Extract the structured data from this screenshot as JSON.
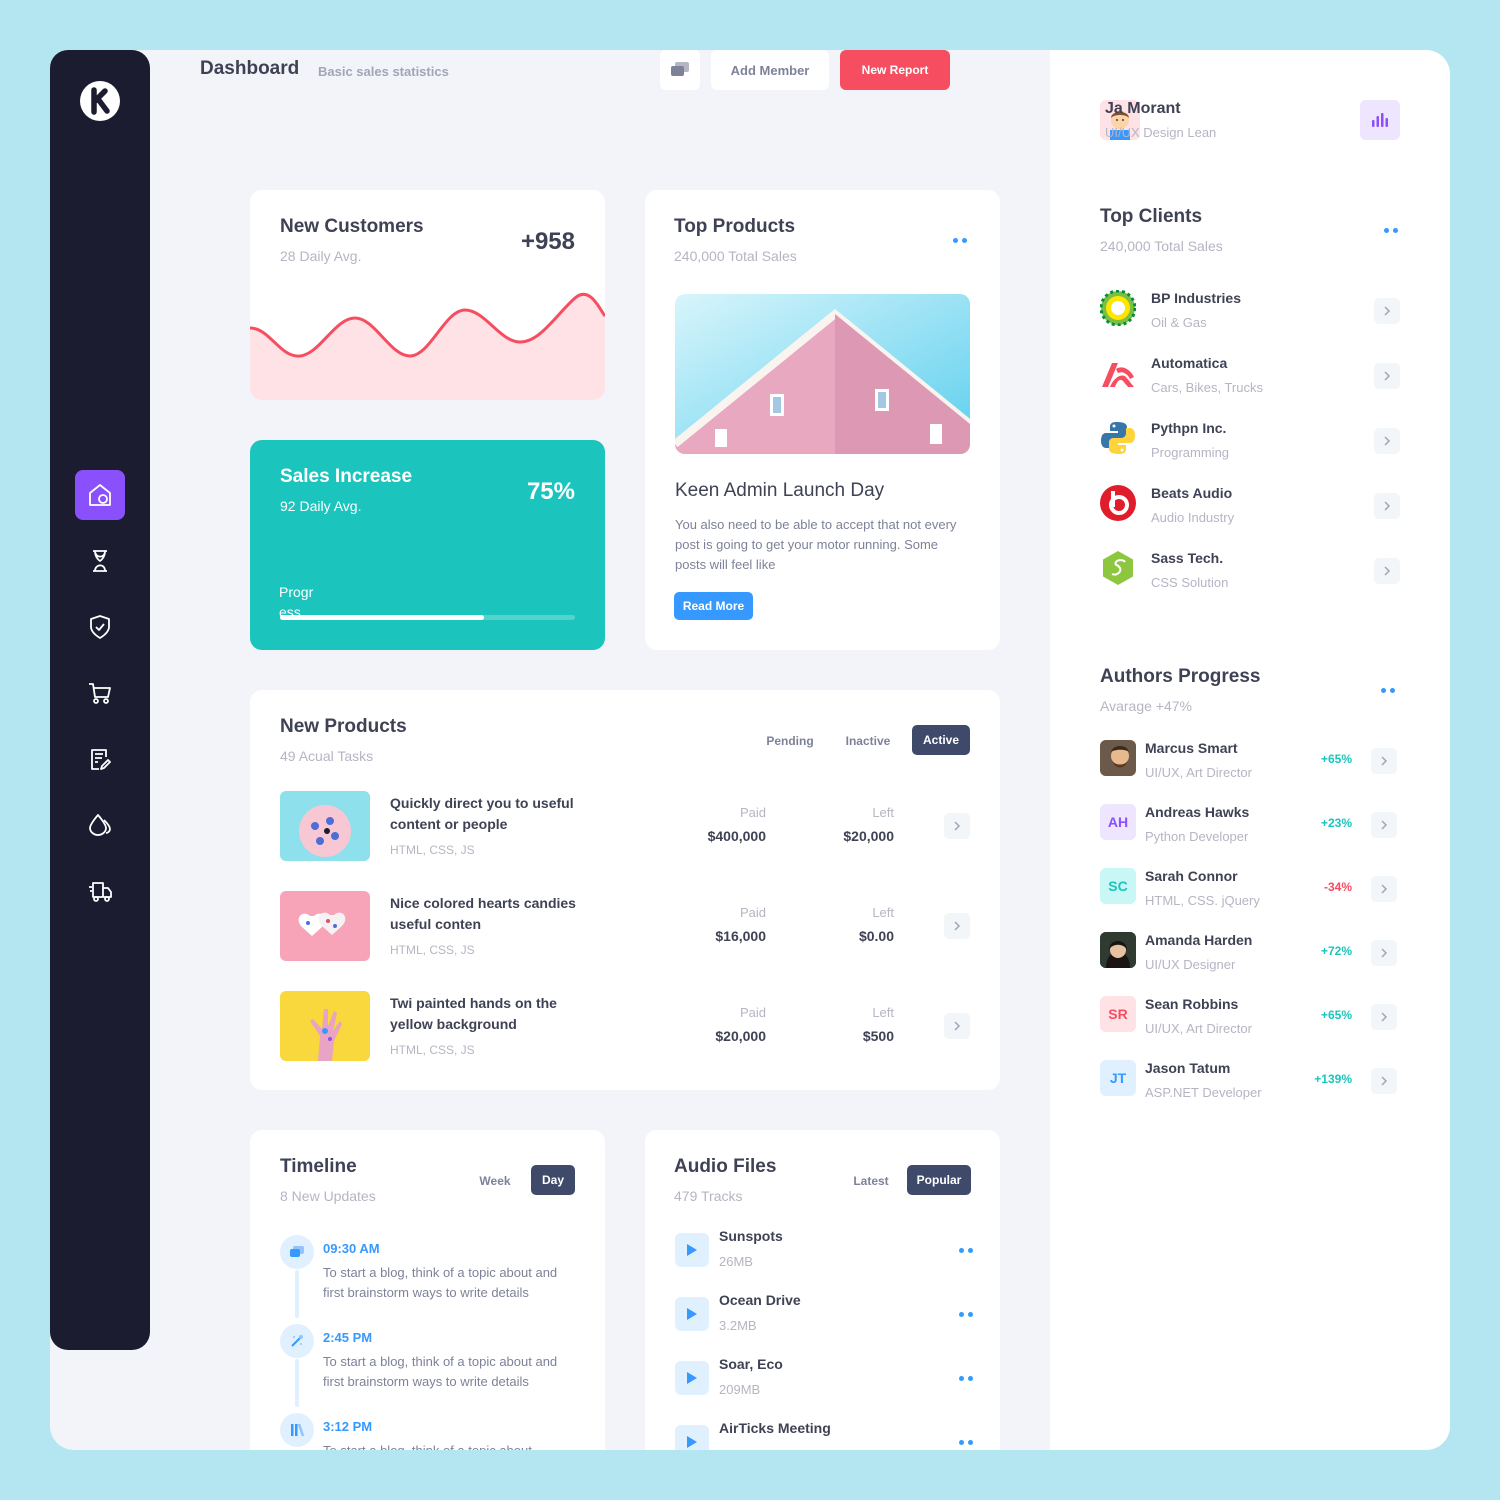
{
  "header": {
    "title": "Dashboard",
    "subtitle": "Basic sales statistics",
    "add_member": "Add Member",
    "new_report": "New Report"
  },
  "sidebar": {
    "items": [
      {
        "icon": "home-icon",
        "active": true
      },
      {
        "icon": "hourglass-icon",
        "active": false
      },
      {
        "icon": "shield-check-icon",
        "active": false
      },
      {
        "icon": "cart-icon",
        "active": false
      },
      {
        "icon": "document-edit-icon",
        "active": false
      },
      {
        "icon": "drops-icon",
        "active": false
      },
      {
        "icon": "truck-icon",
        "active": false
      }
    ]
  },
  "new_customers": {
    "title": "New Customers",
    "subtitle": "28 Daily Avg.",
    "value": "+958"
  },
  "sales_increase": {
    "title": "Sales Increase",
    "subtitle": "92 Daily Avg.",
    "value": "75%",
    "progress_label": "Progr ess",
    "progress": 0.69
  },
  "top_products": {
    "title": "Top Products",
    "subtitle": "240,000 Total Sales",
    "post_title": "Keen Admin Launch Day",
    "post_text": "You also need to be able to accept that not every post is going to get your motor running. Some posts will feel like",
    "read_more": "Read More"
  },
  "new_products": {
    "title": "New Products",
    "subtitle": "49 Acual Tasks",
    "tabs": [
      "Pending",
      "Inactive",
      "Active"
    ],
    "paid_label": "Paid",
    "left_label": "Left",
    "rows": [
      {
        "name": "Quickly direct you to useful content or people",
        "tags": "HTML, CSS, JS",
        "paid": "$400,000",
        "left": "$20,000"
      },
      {
        "name": "Nice colored hearts candies useful conten",
        "tags": "HTML, CSS, JS",
        "paid": "$16,000",
        "left": "$0.00"
      },
      {
        "name": "Twi painted hands on the yellow background",
        "tags": "HTML, CSS, JS",
        "paid": "$20,000",
        "left": "$500"
      }
    ]
  },
  "timeline": {
    "title": "Timeline",
    "subtitle": "8 New Updates",
    "tabs": [
      "Week",
      "Day"
    ],
    "items": [
      {
        "time": "09:30 AM",
        "text": "To start a blog, think of a topic about and first brainstorm ways to write details"
      },
      {
        "time": "2:45 PM",
        "text": "To start a blog, think of a topic about and first brainstorm ways to write details"
      },
      {
        "time": "3:12 PM",
        "text": "To start a blog, think of a topic about"
      }
    ]
  },
  "audio": {
    "title": "Audio Files",
    "subtitle": "479 Tracks",
    "tabs": [
      "Latest",
      "Popular"
    ],
    "tracks": [
      {
        "name": "Sunspots",
        "size": "26MB"
      },
      {
        "name": "Ocean Drive",
        "size": "3.2MB"
      },
      {
        "name": "Soar, Eco",
        "size": "209MB"
      },
      {
        "name": "AirTicks Meeting",
        "size": ""
      }
    ]
  },
  "profile": {
    "name": "Ja Morant",
    "role": "UI/UX Design Lean"
  },
  "top_clients": {
    "title": "Top Clients",
    "subtitle": "240,000 Total Sales",
    "clients": [
      {
        "name": "BP Industries",
        "desc": "Oil & Gas",
        "logo": "bp-logo-icon"
      },
      {
        "name": "Automatica",
        "desc": "Cars, Bikes, Trucks",
        "logo": "automatica-logo-icon"
      },
      {
        "name": "Pythpn Inc.",
        "desc": "Programming",
        "logo": "python-logo-icon"
      },
      {
        "name": "Beats Audio",
        "desc": "Audio Industry",
        "logo": "beats-logo-icon"
      },
      {
        "name": "Sass Tech.",
        "desc": "CSS Solution",
        "logo": "sass-logo-icon"
      }
    ]
  },
  "authors": {
    "title": "Authors Progress",
    "subtitle": "Avarage +47%",
    "list": [
      {
        "name": "Marcus Smart",
        "role": "UI/UX, Art Director",
        "pct": "+65%",
        "initials": "",
        "color": "#1bc5bd"
      },
      {
        "name": "Andreas Hawks",
        "role": "Python Developer",
        "pct": "+23%",
        "initials": "AH",
        "color": "#1bc5bd"
      },
      {
        "name": "Sarah Connor",
        "role": "HTML, CSS. jQuery",
        "pct": "-34%",
        "initials": "SC",
        "color": "#f64e60"
      },
      {
        "name": "Amanda Harden",
        "role": "UI/UX Designer",
        "pct": "+72%",
        "initials": "",
        "color": "#1bc5bd"
      },
      {
        "name": "Sean Robbins",
        "role": "UI/UX, Art Director",
        "pct": "+65%",
        "initials": "SR",
        "color": "#1bc5bd"
      },
      {
        "name": "Jason Tatum",
        "role": "ASP.NET Developer",
        "pct": "+139%",
        "initials": "JT",
        "color": "#1bc5bd"
      }
    ]
  },
  "colors": {
    "accent": "#8950fc",
    "danger": "#f64e60",
    "success": "#1bc5bd",
    "primary": "#3699ff",
    "dark": "#1b1c30"
  }
}
